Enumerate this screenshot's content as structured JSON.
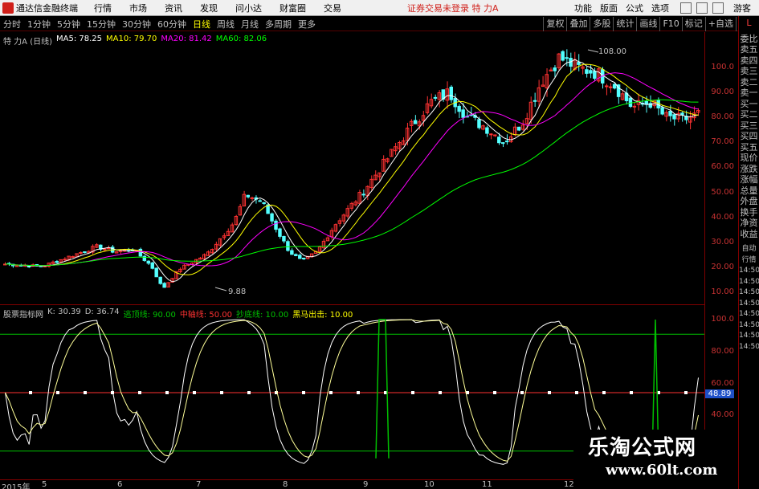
{
  "topbar": {
    "app_name": "通达信金融终端",
    "menu": [
      "行情",
      "市场",
      "资讯",
      "发现",
      "问小达",
      "财富圈",
      "交易"
    ],
    "notice": "证券交易未登录  特 力A",
    "right": [
      "功能",
      "版面",
      "公式",
      "选项"
    ],
    "guest": "游客"
  },
  "tabs": [
    "分时",
    "1分钟",
    "5分钟",
    "15分钟",
    "30分钟",
    "60分钟",
    "日线",
    "周线",
    "月线",
    "多周期",
    "更多"
  ],
  "active_tab": "日线",
  "tools": [
    "复权",
    "叠加",
    "多股",
    "统计",
    "画线",
    "F10",
    "标记",
    "+自选",
    "返回"
  ],
  "main_legend": {
    "stock": "特 力A (日线)",
    "ma5": "MA5: 78.25",
    "ma10": "MA10: 79.70",
    "ma20": "MA20: 81.42",
    "ma60": "MA60: 82.06"
  },
  "ind_legend": {
    "name": "股票指标网",
    "k": "K: 30.39",
    "d": "D: 36.74",
    "line1": "逃顶线: 90.00",
    "line2": "中轴线: 50.00",
    "line3": "抄底线: 10.00",
    "line4": "黑马出击: 10.00"
  },
  "annotations": {
    "high": "108.00",
    "low": "9.88"
  },
  "price_ticks": [
    "100.0",
    "90.00",
    "80.00",
    "70.00",
    "60.00",
    "50.00",
    "40.00",
    "30.00",
    "20.00",
    "10.00"
  ],
  "ind_ticks": [
    "100.0",
    "80.00",
    "60.00",
    "40.00"
  ],
  "current_value": "48.89",
  "side_labels": [
    "委比",
    "卖五",
    "卖四",
    "卖三",
    "卖二",
    "卖一",
    "买一",
    "买二",
    "买三",
    "买四",
    "买五",
    "现价",
    "涨跌",
    "涨幅",
    "总量",
    "外盘",
    "换手",
    "净资",
    "收益"
  ],
  "side_labels_2": [
    "自动",
    "行情",
    "14:50",
    "14:50",
    "14:50",
    "14:50",
    "14:50",
    "14:50",
    "14:50",
    "14:50"
  ],
  "side_top": "L",
  "date_ticks": [
    "2015年",
    "5",
    "6",
    "7",
    "8",
    "9",
    "10",
    "11",
    "12"
  ],
  "watermark": {
    "title": "乐淘公式网",
    "url": "www.60lt.com"
  },
  "colors": {
    "ma5": "#ffffff",
    "ma10": "#ffff00",
    "ma20": "#ff00ff",
    "ma60": "#00ff00",
    "up": "#ff3232",
    "down": "#54ffff"
  }
}
